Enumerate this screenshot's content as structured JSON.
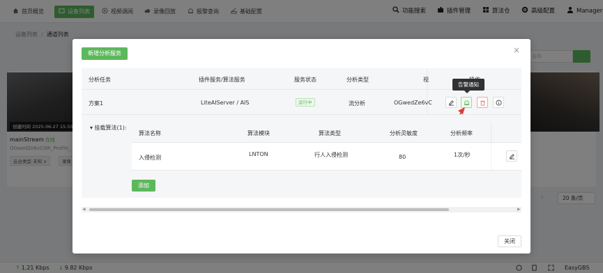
{
  "nav": {
    "items": [
      {
        "label": "首页概览"
      },
      {
        "label": "设备列表"
      },
      {
        "label": "视频调阅"
      },
      {
        "label": "录像回放"
      },
      {
        "label": "报警查询"
      },
      {
        "label": "基础配置"
      }
    ],
    "right": [
      {
        "label": "功能搜索"
      },
      {
        "label": "插件管理"
      },
      {
        "label": "算法仓"
      },
      {
        "label": "高级配置"
      },
      {
        "label": "Manager"
      }
    ]
  },
  "breadcrumb": {
    "parent": "设备列表",
    "sep": "/",
    "current": "通道列表"
  },
  "background": {
    "search_placeholder": "名称",
    "thumb_caption": "创建时间 2025-06-27 15:55",
    "stream_name": "mainStream",
    "stream_status": "在线",
    "stream_id": "OGwedZe6vCl8h_Profile_",
    "ptz_type": "云台类型 未知 ∨",
    "record_label": "录像",
    "page_size": "20 条/页",
    "pager_next": "›"
  },
  "footer": {
    "upload": "1.21 Kbps",
    "download": "9.82 Kbps",
    "brand": "EasyGBS"
  },
  "modal": {
    "add_service_label": "新增分析服务",
    "close_icon": "×",
    "columns": [
      "分析任务",
      "插件服务/算法服务",
      "服务状态",
      "分析类型",
      "视",
      "操作"
    ],
    "row": {
      "task": "方案1",
      "service": "LiteAIServer / AIS",
      "status": "运行中",
      "type": "流分析",
      "channel": "OGwedZe6vC"
    },
    "tooltip": "告警通知",
    "sub_title": "▾ 挂载算法(1):",
    "sub_columns": [
      "算法名称",
      "算法模块",
      "算法类型",
      "分析灵敏度",
      "分析频率"
    ],
    "sub_row": {
      "name": "入侵检测",
      "module": "LNTON",
      "type": "行人入侵检测",
      "sensitivity": "80",
      "frequency": "1次/秒"
    },
    "add_algo_label": "添加",
    "close_button_label": "关闭"
  },
  "colors": {
    "accent": "#5cb85c",
    "danger": "#f56c6c",
    "annotation_arrow": "#e53935"
  }
}
